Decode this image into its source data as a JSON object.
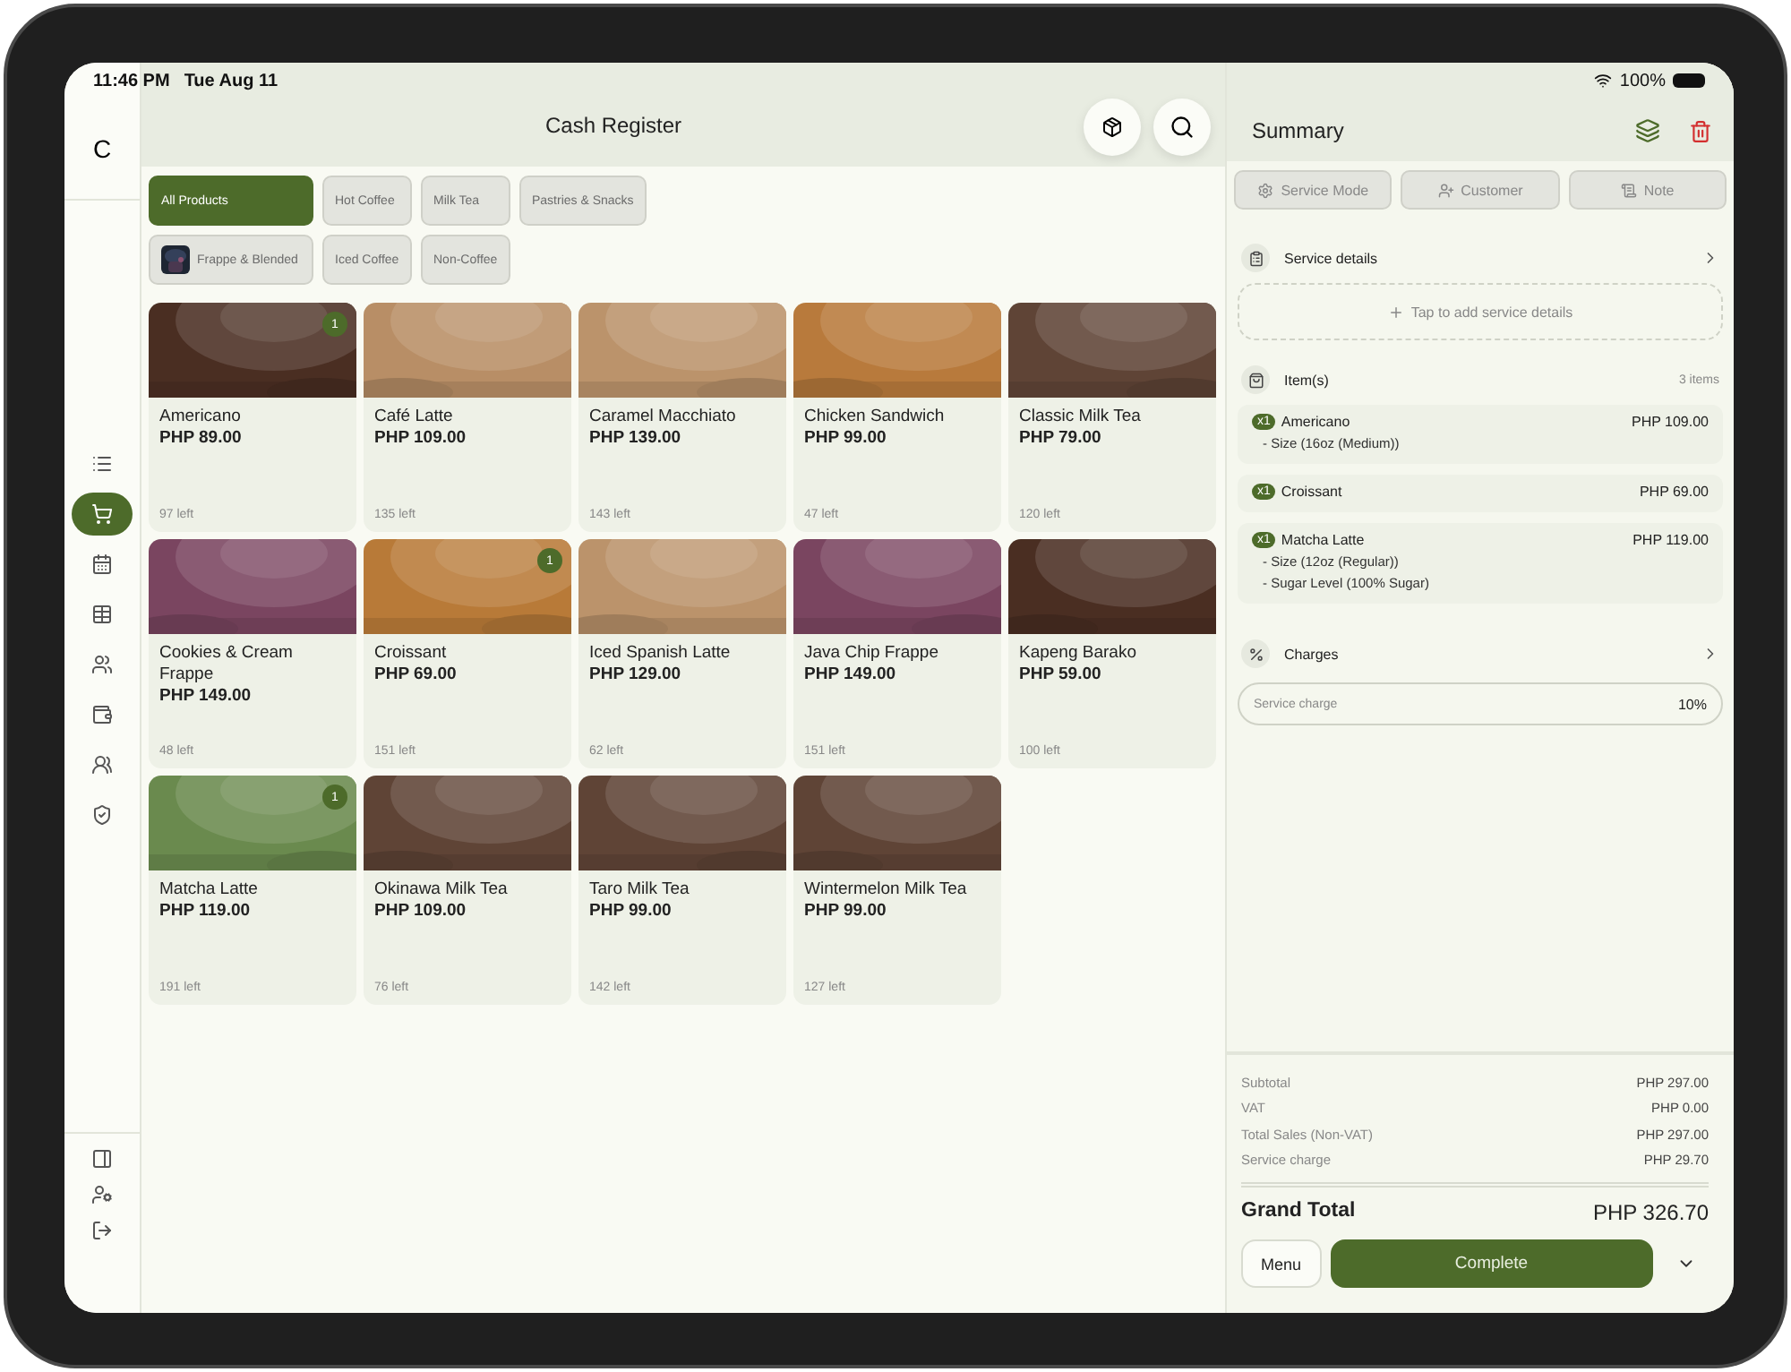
{
  "status_bar": {
    "time": "11:46 PM",
    "date": "Tue Aug 11",
    "battery": "100%"
  },
  "sidebar": {
    "logo": "C",
    "items": [
      {
        "selected": false
      },
      {
        "selected": true
      },
      {
        "selected": false
      },
      {
        "selected": false
      },
      {
        "selected": false
      },
      {
        "selected": false
      },
      {
        "selected": false
      },
      {
        "selected": false
      }
    ]
  },
  "header": {
    "title": "Cash Register"
  },
  "categories": [
    {
      "label": "All Products",
      "selected": true,
      "kind": "text"
    },
    {
      "label": "Hot Coffee",
      "selected": false,
      "kind": "text"
    },
    {
      "label": "Milk Tea",
      "selected": false,
      "kind": "text"
    },
    {
      "label": "Pastries & Snacks",
      "selected": false,
      "kind": "text"
    },
    {
      "label": "Frappe & Blended",
      "selected": false,
      "kind": "picture"
    },
    {
      "label": "Iced Coffee",
      "selected": false,
      "kind": "text"
    },
    {
      "label": "Non-Coffee",
      "selected": false,
      "kind": "text"
    }
  ],
  "products": [
    {
      "name": "Americano",
      "price": "PHP 89.00",
      "stock": "97 left",
      "count": "1",
      "color": "#4a2e22"
    },
    {
      "name": "Café Latte",
      "price": "PHP 109.00",
      "stock": "135 left",
      "color": "#b88e66"
    },
    {
      "name": "Caramel Macchiato",
      "price": "PHP 139.00",
      "stock": "143 left",
      "color": "#bb936b"
    },
    {
      "name": "Chicken Sandwich",
      "price": "PHP 99.00",
      "stock": "47 left",
      "color": "#b87a3c"
    },
    {
      "name": "Classic Milk Tea",
      "price": "PHP 79.00",
      "stock": "120 left",
      "color": "#5f4436"
    },
    {
      "name": "Cookies & Cream Frappe",
      "price": "PHP 149.00",
      "stock": "48 left",
      "color": "#7a4560"
    },
    {
      "name": "Croissant",
      "price": "PHP 69.00",
      "stock": "151 left",
      "count": "1",
      "color": "#b87a38"
    },
    {
      "name": "Iced Spanish Latte",
      "price": "PHP 129.00",
      "stock": "62 left",
      "color": "#bb936b"
    },
    {
      "name": "Java Chip Frappe",
      "price": "PHP 149.00",
      "stock": "151 left",
      "color": "#7a4560"
    },
    {
      "name": "Kapeng Barako",
      "price": "PHP 59.00",
      "stock": "100 left",
      "color": "#4a2e22"
    },
    {
      "name": "Matcha Latte",
      "price": "PHP 119.00",
      "stock": "191 left",
      "count": "1",
      "color": "#6a8a4e"
    },
    {
      "name": "Okinawa Milk Tea",
      "price": "PHP 109.00",
      "stock": "76 left",
      "color": "#5f4436"
    },
    {
      "name": "Taro Milk Tea",
      "price": "PHP 99.00",
      "stock": "142 left",
      "color": "#5f4436"
    },
    {
      "name": "Wintermelon Milk Tea",
      "price": "PHP 99.00",
      "stock": "127 left",
      "color": "#5f4436"
    }
  ],
  "summary": {
    "title": "Summary",
    "actions": [
      {
        "label": "Service Mode"
      },
      {
        "label": "Customer"
      },
      {
        "label": "Note"
      }
    ],
    "service_details": {
      "title": "Service details",
      "placeholder": "Tap to add service details"
    },
    "items_section": {
      "title": "Item(s)",
      "count": "3 items"
    },
    "items": [
      {
        "qty": "x1",
        "name": "Americano",
        "price": "PHP 109.00",
        "options": [
          "- Size (16oz (Medium))"
        ]
      },
      {
        "qty": "x1",
        "name": "Croissant",
        "price": "PHP 69.00"
      },
      {
        "qty": "x1",
        "name": "Matcha Latte",
        "price": "PHP 119.00",
        "options": [
          "- Size (12oz (Regular))",
          "- Sugar Level (100% Sugar)"
        ]
      }
    ],
    "charges": {
      "title": "Charges",
      "rows": [
        {
          "label": "Service charge",
          "value": "10%"
        }
      ]
    },
    "totals": [
      {
        "label": "Subtotal",
        "value": "PHP 297.00"
      },
      {
        "label": "VAT",
        "value": "PHP 0.00"
      },
      {
        "label": "Total Sales (Non-VAT)",
        "value": "PHP 297.00"
      },
      {
        "label": "Service charge",
        "value": "PHP 29.70"
      }
    ],
    "grand_total": {
      "label": "Grand Total",
      "value": "PHP 326.70"
    },
    "buttons": {
      "menu": "Menu",
      "complete": "Complete"
    }
  }
}
